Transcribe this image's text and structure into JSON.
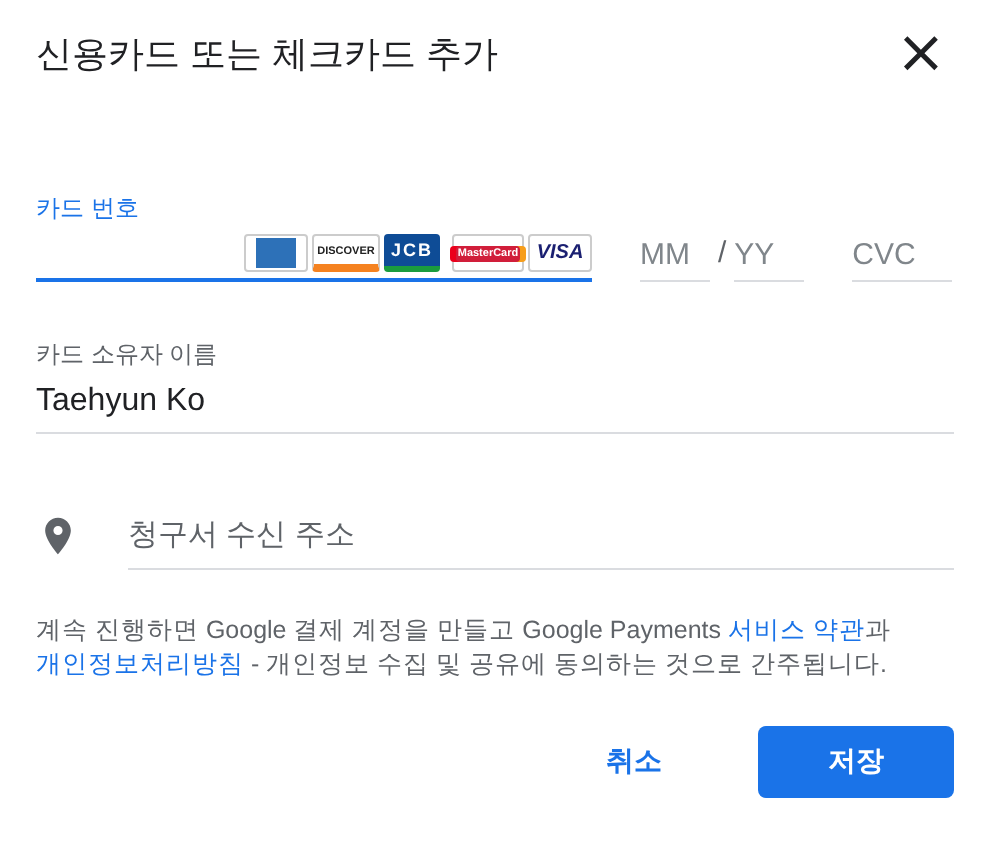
{
  "dialog": {
    "title": "신용카드 또는 체크카드 추가",
    "close": "×"
  },
  "card_number": {
    "label": "카드 번호",
    "focused": true,
    "card_logos": [
      {
        "kind": "amex"
      },
      {
        "kind": "discover",
        "text": "DISCOVER"
      },
      {
        "kind": "jcb",
        "text": "JCB"
      },
      {
        "kind": "mastercard",
        "text": "MasterCard"
      },
      {
        "kind": "visa",
        "text": "VISA"
      }
    ]
  },
  "expiry": {
    "month": {
      "placeholder": "MM"
    },
    "separator": "/",
    "year": {
      "placeholder": "YY"
    }
  },
  "cvc": {
    "placeholder": "CVC"
  },
  "cardholder": {
    "label": "카드 소유자 이름",
    "value": "Taehyun Ko"
  },
  "billing_address": {
    "placeholder": "청구서 수신 주소"
  },
  "notice": [
    {
      "kind": "text",
      "text": "계속 진행하면 Google 결제 계정을 만들고 Google Payments "
    },
    {
      "kind": "link",
      "text": "서비스 약관"
    },
    {
      "kind": "text",
      "text": "과 "
    },
    {
      "kind": "link",
      "text": "개인정보처리방침"
    },
    {
      "kind": "text",
      "text": " - 개인정보 수집 및 공유에 동의하는 것으로 간주됩니다."
    }
  ],
  "buttons": [
    {
      "kind": "text",
      "label": "취소"
    },
    {
      "kind": "primary",
      "label": "저장"
    }
  ]
}
